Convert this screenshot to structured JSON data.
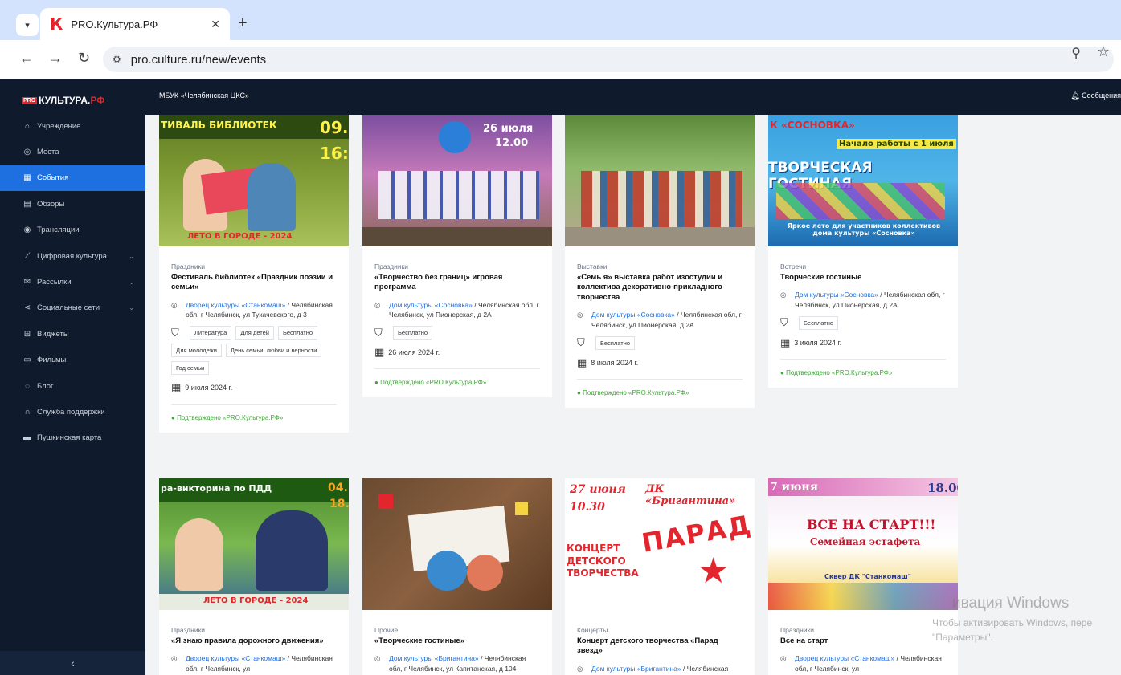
{
  "browser": {
    "tab_title": "PRO.Культура.РФ",
    "url": "pro.culture.ru/new/events"
  },
  "sidebar": {
    "logo_pro": "PRO",
    "logo_main": "КУЛЬТУРА.",
    "logo_rf": "РФ",
    "items": [
      {
        "label": "Учреждение",
        "icon": "home-icon"
      },
      {
        "label": "Места",
        "icon": "location-icon"
      },
      {
        "label": "События",
        "icon": "calendar-icon",
        "active": true
      },
      {
        "label": "Обзоры",
        "icon": "document-icon"
      },
      {
        "label": "Трансляции",
        "icon": "broadcast-icon"
      },
      {
        "label": "Цифровая культура",
        "icon": "chart-icon",
        "chevron": true
      },
      {
        "label": "Рассылки",
        "icon": "mail-icon",
        "chevron": true
      },
      {
        "label": "Социальные сети",
        "icon": "share-icon",
        "chevron": true
      },
      {
        "label": "Виджеты",
        "icon": "grid-icon"
      },
      {
        "label": "Фильмы",
        "icon": "film-icon"
      },
      {
        "label": "Блог",
        "icon": "chat-icon"
      },
      {
        "label": "Служба поддержки",
        "icon": "headset-icon"
      },
      {
        "label": "Пушкинская карта",
        "icon": "card-icon"
      }
    ]
  },
  "topbar": {
    "org": "МБУК «Челябинская ЦКС»",
    "messages": "Сообщения"
  },
  "cards": [
    {
      "category": "Праздники",
      "title": "Фестиваль библиотек «Праздник поэзии и семьи»",
      "venue": "Дворец культуры «Станкомаш»",
      "address": " / Челябинская обл, г Челябинск, ул Тухачевского, д 3",
      "tags": [
        "Литература",
        "Для детей",
        "Бесплатно",
        "Для молодежи",
        "День семьи, любви и верности",
        "Год семьи"
      ],
      "date": "9 июля 2024 г.",
      "verified": "Подтверждено «PRO.Культура.РФ»",
      "img": {
        "line1": "ТИВАЛЬ БИБЛИОТЕК",
        "line2": "09.",
        "line3": "16:",
        "line4": "ЛЕТО В ГОРОДЕ - 2024"
      }
    },
    {
      "category": "Праздники",
      "title": "«Творчество без границ» игровая программа",
      "venue": "Дом культуры «Сосновка»",
      "address": " / Челябинская обл, г Челябинск, ул Пионерская, д 2А",
      "tags": [
        "Бесплатно"
      ],
      "date": "26 июля 2024 г.",
      "verified": "Подтверждено «PRO.Культура.РФ»",
      "img": {
        "line1": "26 июля",
        "line2": "12.00"
      }
    },
    {
      "category": "Выставки",
      "title": "«Семь я» выставка работ изостудии и коллектива декоративно-прикладного творчества",
      "venue": "Дом культуры «Сосновка»",
      "address": " / Челябинская обл, г Челябинск, ул Пионерская, д 2А",
      "tags": [
        "Бесплатно"
      ],
      "date": "8 июля 2024 г.",
      "verified": "Подтверждено «PRO.Культура.РФ»",
      "img": {}
    },
    {
      "category": "Встречи",
      "title": "Творческие гостиные",
      "venue": "Дом культуры «Сосновка»",
      "address": " / Челябинская обл, г Челябинск, ул Пионерская, д 2А",
      "tags": [
        "Бесплатно"
      ],
      "date": "3 июля 2024 г.",
      "verified": "Подтверждено «PRO.Культура.РФ»",
      "img": {
        "line1": "К «СОСНОВКА»",
        "line2": "Начало работы с 1 июля",
        "line3": "ТВОРЧЕСКАЯ ГОСТИНАЯ",
        "line4": "Яркое лето для участников коллективов дома культуры «Сосновка»"
      }
    },
    {
      "category": "Праздники",
      "title": "«Я знаю правила дорожного движения»",
      "venue": "Дворец культуры «Станкомаш»",
      "address": " / Челябинская обл, г Челябинск, ул",
      "img": {
        "line1": "ра-викторина по ПДД",
        "line2": "04.",
        "line3": "18.",
        "line4": "ЛЕТО В ГОРОДЕ - 2024"
      }
    },
    {
      "category": "Прочие",
      "title": "«Творческие гостиные»",
      "venue": "Дом культуры «Бригантина»",
      "address": " / Челябинская обл, г Челябинск, ул Капитанская, д 104",
      "img": {}
    },
    {
      "category": "Концерты",
      "title": "Концерт детского творчества «Парад звезд»",
      "venue": "Дом культуры «Бригантина»",
      "address": " / Челябинская",
      "img": {
        "line1": "27 июня",
        "line2": "ДК «Бригантина»",
        "line3": "10.30",
        "line4": "ПАРАД",
        "line5": "КОНЦЕРТ ДЕТСКОГО ТВОРЧЕСТВА"
      }
    },
    {
      "category": "Праздники",
      "title": "Все на старт",
      "venue": "Дворец культуры «Станкомаш»",
      "address": " / Челябинская обл, г Челябинск, ул",
      "img": {
        "line1": "7 июня",
        "line2": "18.00",
        "line3": "ВСЕ НА СТАРТ!!!",
        "line4": "Семейная эстафета",
        "line5": "Сквер ДК \"Станкомаш\""
      }
    }
  ],
  "watermark": {
    "line1": "ивация Windows",
    "line2": "Чтобы активировать Windows, пере",
    "line3": "\"Параметры\"."
  }
}
